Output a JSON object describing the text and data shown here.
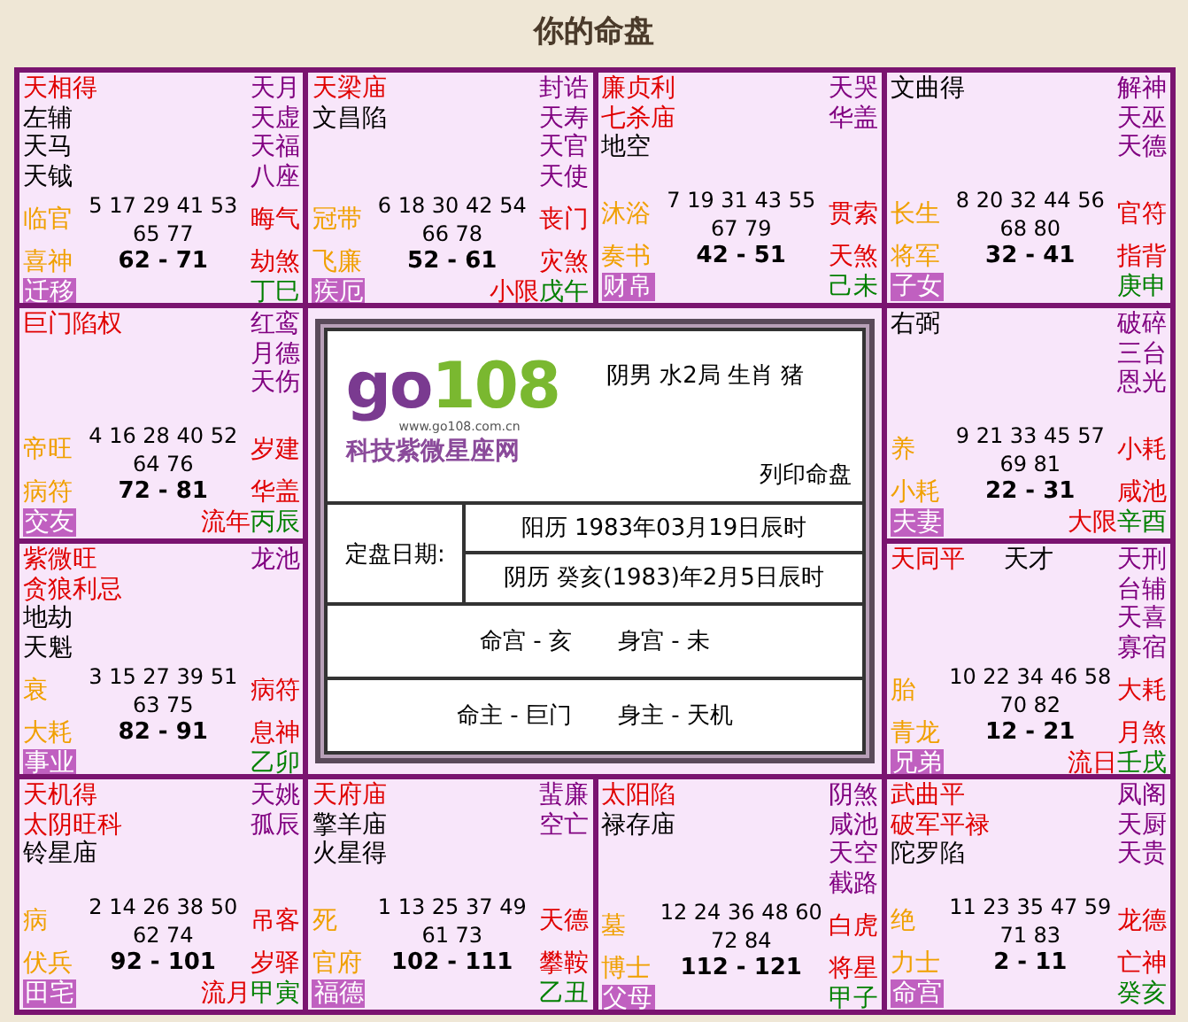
{
  "title": "你的命盘",
  "palaces": [
    {
      "stars": [
        [
          {
            "text": "天相得",
            "kind": "major"
          }
        ],
        [
          {
            "text": "左辅",
            "kind": "minor"
          }
        ],
        [
          {
            "text": "天马",
            "kind": "minor"
          }
        ],
        [
          {
            "text": "天钺",
            "kind": "minor"
          }
        ]
      ],
      "side": [
        "天月",
        "天虚",
        "天福",
        "八座"
      ],
      "phase": "临官",
      "years": [
        "5 17 29 41 53",
        "65 77"
      ],
      "star_a": "晦气",
      "spirit": "喜神",
      "ages": "62 - 71",
      "star_b": "劫煞",
      "tag": "迁移",
      "branch": "丁巳"
    },
    {
      "stars": [
        [
          {
            "text": "天梁庙",
            "kind": "major"
          }
        ],
        [
          {
            "text": "文昌陷",
            "kind": "minor"
          }
        ]
      ],
      "side": [
        "封诰",
        "天寿",
        "天官",
        "天使"
      ],
      "phase": "冠带",
      "years": [
        "6 18 30 42 54",
        "66 78"
      ],
      "star_a": "丧门",
      "spirit": "飞廉",
      "ages": "52 - 61",
      "star_b": "灾煞",
      "tag": "疾厄",
      "marker": "小限",
      "branch": "戊午"
    },
    {
      "stars": [
        [
          {
            "text": "廉贞利",
            "kind": "major"
          }
        ],
        [
          {
            "text": "七杀庙",
            "kind": "major"
          }
        ],
        [
          {
            "text": "地空",
            "kind": "minor"
          }
        ]
      ],
      "side": [
        "天哭",
        "华盖"
      ],
      "phase": "沐浴",
      "years": [
        "7 19 31 43 55",
        "67 79"
      ],
      "star_a": "贯索",
      "spirit": "奏书",
      "ages": "42 - 51",
      "star_b": "天煞",
      "tag": "财帛",
      "branch": "己未"
    },
    {
      "stars": [
        [
          {
            "text": "文曲得",
            "kind": "minor"
          }
        ]
      ],
      "side": [
        "解神",
        "天巫",
        "天德"
      ],
      "phase": "长生",
      "years": [
        "8 20 32 44 56",
        "68 80"
      ],
      "star_a": "官符",
      "spirit": "将军",
      "ages": "32 - 41",
      "star_b": "指背",
      "tag": "子女",
      "branch": "庚申"
    },
    {
      "stars": [
        [
          {
            "text": "巨门陷权",
            "kind": "major"
          }
        ]
      ],
      "side": [
        "红鸾",
        "月德",
        "天伤"
      ],
      "phase": "帝旺",
      "years": [
        "4 16 28 40 52",
        "64 76"
      ],
      "star_a": "岁建",
      "spirit": "病符",
      "ages": "72 - 81",
      "star_b": "华盖",
      "tag": "交友",
      "marker": "流年",
      "branch": "丙辰"
    },
    {
      "stars": [
        [
          {
            "text": "右弼",
            "kind": "minor"
          }
        ]
      ],
      "side": [
        "破碎",
        "三台",
        "恩光"
      ],
      "phase": "养",
      "years": [
        "9 21 33 45 57",
        "69 81"
      ],
      "star_a": "小耗",
      "spirit": "小耗",
      "ages": "22 - 31",
      "star_b": "咸池",
      "tag": "夫妻",
      "marker": "大限",
      "branch": "辛酉"
    },
    {
      "stars": [
        [
          {
            "text": "紫微旺",
            "kind": "major"
          }
        ],
        [
          {
            "text": "贪狼利忌",
            "kind": "major"
          }
        ],
        [
          {
            "text": "地劫",
            "kind": "minor"
          }
        ],
        [
          {
            "text": "天魁",
            "kind": "minor"
          }
        ]
      ],
      "side": [
        "龙池"
      ],
      "phase": "衰",
      "years": [
        "3 15 27 39 51",
        "63 75"
      ],
      "star_a": "病符",
      "spirit": "大耗",
      "ages": "82 - 91",
      "star_b": "息神",
      "tag": "事业",
      "branch": "乙卯"
    },
    {
      "stars": [
        [
          {
            "text": "天同平",
            "kind": "major"
          },
          {
            "text": "天才",
            "kind": "minor"
          }
        ]
      ],
      "side": [
        "天刑",
        "台辅",
        "天喜",
        "寡宿"
      ],
      "phase": "胎",
      "years": [
        "10 22 34 46 58",
        "70 82"
      ],
      "star_a": "大耗",
      "spirit": "青龙",
      "ages": "12 - 21",
      "star_b": "月煞",
      "tag": "兄弟",
      "marker": "流日",
      "branch": "壬戌"
    },
    {
      "stars": [
        [
          {
            "text": "天机得",
            "kind": "major"
          }
        ],
        [
          {
            "text": "太阴旺科",
            "kind": "major"
          }
        ],
        [
          {
            "text": "铃星庙",
            "kind": "minor"
          }
        ]
      ],
      "side": [
        "天姚",
        "孤辰"
      ],
      "phase": "病",
      "years": [
        "2 14 26 38 50",
        "62 74"
      ],
      "star_a": "吊客",
      "spirit": "伏兵",
      "ages": "92 - 101",
      "star_b": "岁驿",
      "tag": "田宅",
      "marker": "流月",
      "branch": "甲寅"
    },
    {
      "stars": [
        [
          {
            "text": "天府庙",
            "kind": "major"
          }
        ],
        [
          {
            "text": "擎羊庙",
            "kind": "minor"
          }
        ],
        [
          {
            "text": "火星得",
            "kind": "minor"
          }
        ]
      ],
      "side": [
        "蜚廉",
        "空亡"
      ],
      "phase": "死",
      "years": [
        "1 13 25 37 49",
        "61 73"
      ],
      "star_a": "天德",
      "spirit": "官府",
      "ages": "102 - 111",
      "star_b": "攀鞍",
      "tag": "福德",
      "branch": "乙丑"
    },
    {
      "stars": [
        [
          {
            "text": "太阳陷",
            "kind": "major"
          }
        ],
        [
          {
            "text": "禄存庙",
            "kind": "minor"
          }
        ]
      ],
      "side": [
        "阴煞",
        "咸池",
        "天空",
        "截路"
      ],
      "phase": "墓",
      "years": [
        "12 24 36 48 60",
        "72 84"
      ],
      "star_a": "白虎",
      "spirit": "博士",
      "ages": "112 - 121",
      "star_b": "将星",
      "tag": "父母",
      "branch": "甲子"
    },
    {
      "stars": [
        [
          {
            "text": "武曲平",
            "kind": "major"
          }
        ],
        [
          {
            "text": "破军平禄",
            "kind": "major"
          }
        ],
        [
          {
            "text": "陀罗陷",
            "kind": "minor"
          }
        ]
      ],
      "side": [
        "凤阁",
        "天厨",
        "天贵"
      ],
      "phase": "绝",
      "years": [
        "11 23 35 47 59",
        "71 83"
      ],
      "star_a": "龙德",
      "spirit": "力士",
      "ages": "2 - 11",
      "star_b": "亡神",
      "tag": "命宫",
      "branch": "癸亥"
    }
  ],
  "center": {
    "logo": {
      "word": "go108",
      "url": "www.go108.com.cn",
      "tagline": "科技紫微星座网"
    },
    "profile": "阴男 水2局 生肖 猪",
    "print_link": "列印命盘",
    "date_label": "定盘日期:",
    "dates": [
      "阳历 1983年03月19日辰时",
      "阴历 癸亥(1983)年2月5日辰时"
    ],
    "lines": [
      [
        "命宫 - 亥",
        "身宫 - 未"
      ],
      [
        "命主 - 巨门",
        "身主 - 天机"
      ]
    ]
  }
}
